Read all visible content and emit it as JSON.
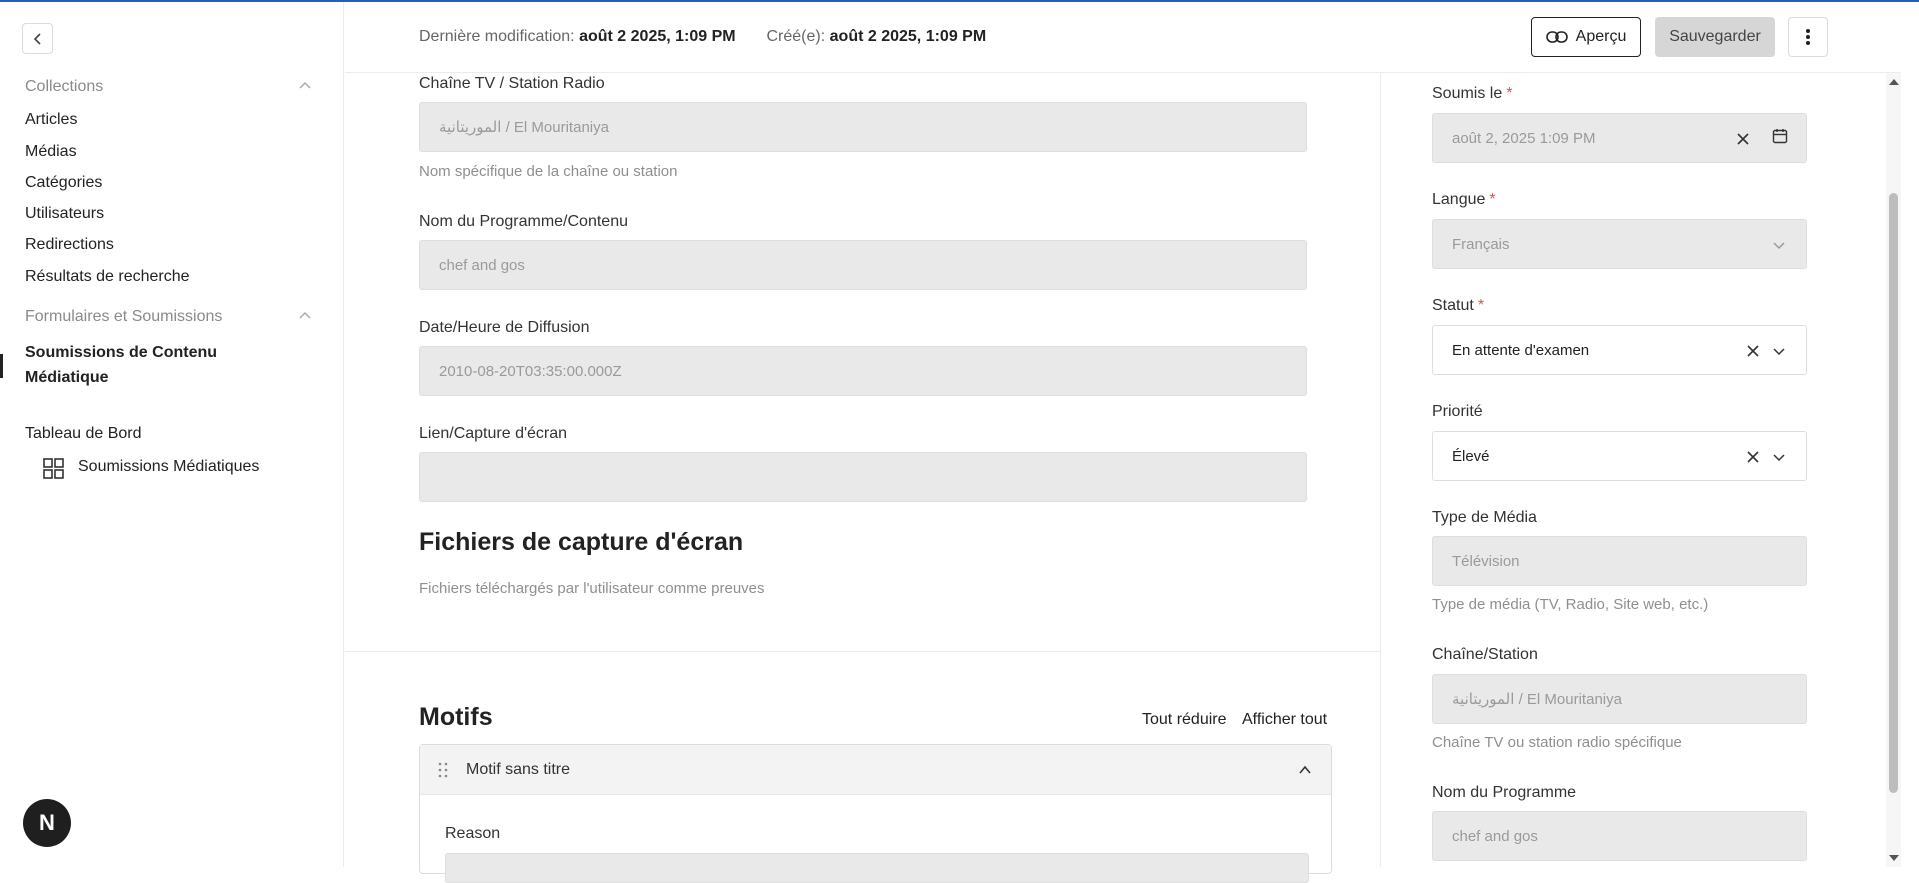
{
  "sidebar": {
    "groups": [
      {
        "title": "Collections",
        "items": [
          "Articles",
          "Médias",
          "Catégories",
          "Utilisateurs",
          "Redirections",
          "Résultats de recherche"
        ]
      },
      {
        "title": "Formulaires et Soumissions",
        "items": [
          "Soumissions de Contenu Médiatique"
        ]
      }
    ],
    "dashboard_title": "Tableau de Bord",
    "dashboard_item": "Soumissions Médiatiques",
    "avatar_initial": "N"
  },
  "header": {
    "modified_label": "Dernière modification:",
    "modified_value": "août 2 2025, 1:09 PM",
    "created_label": "Créé(e):",
    "created_value": "août 2 2025, 1:09 PM",
    "preview_label": "Aperçu",
    "save_label": "Sauvegarder"
  },
  "main": {
    "fields": [
      {
        "label": "Chaîne TV / Station Radio",
        "value": "الموريتانية / El Mouritaniya",
        "help": "Nom spécifique de la chaîne ou station"
      },
      {
        "label": "Nom du Programme/Contenu",
        "value": "chef and gos",
        "help": ""
      },
      {
        "label": "Date/Heure de Diffusion",
        "value": "2010-08-20T03:35:00.000Z",
        "help": ""
      },
      {
        "label": "Lien/Capture d'écran",
        "value": "",
        "help": ""
      }
    ],
    "screenshots_title": "Fichiers de capture d'écran",
    "screenshots_desc": "Fichiers téléchargés par l'utilisateur comme preuves",
    "motifs_title": "Motifs",
    "collapse_all": "Tout réduire",
    "show_all": "Afficher tout",
    "motif_row_title": "Motif sans titre",
    "reason_label": "Reason"
  },
  "right_panel": {
    "submitted_label": "Soumis le",
    "submitted_value": "août 2, 2025 1:09 PM",
    "language_label": "Langue",
    "language_value": "Français",
    "status_label": "Statut",
    "status_value": "En attente d'examen",
    "priority_label": "Priorité",
    "priority_value": "Élevé",
    "media_type_label": "Type de Média",
    "media_type_value": "Télévision",
    "media_type_help": "Type de média (TV, Radio, Site web, etc.)",
    "channel_label": "Chaîne/Station",
    "channel_value": "الموريتانية / El Mouritaniya",
    "channel_help": "Chaîne TV ou station radio spécifique",
    "program_label": "Nom du Programme",
    "program_value": "chef and gos",
    "required_marker": "*"
  },
  "colors": {
    "accent_line": "#2a5db0",
    "required": "#d9534f"
  }
}
